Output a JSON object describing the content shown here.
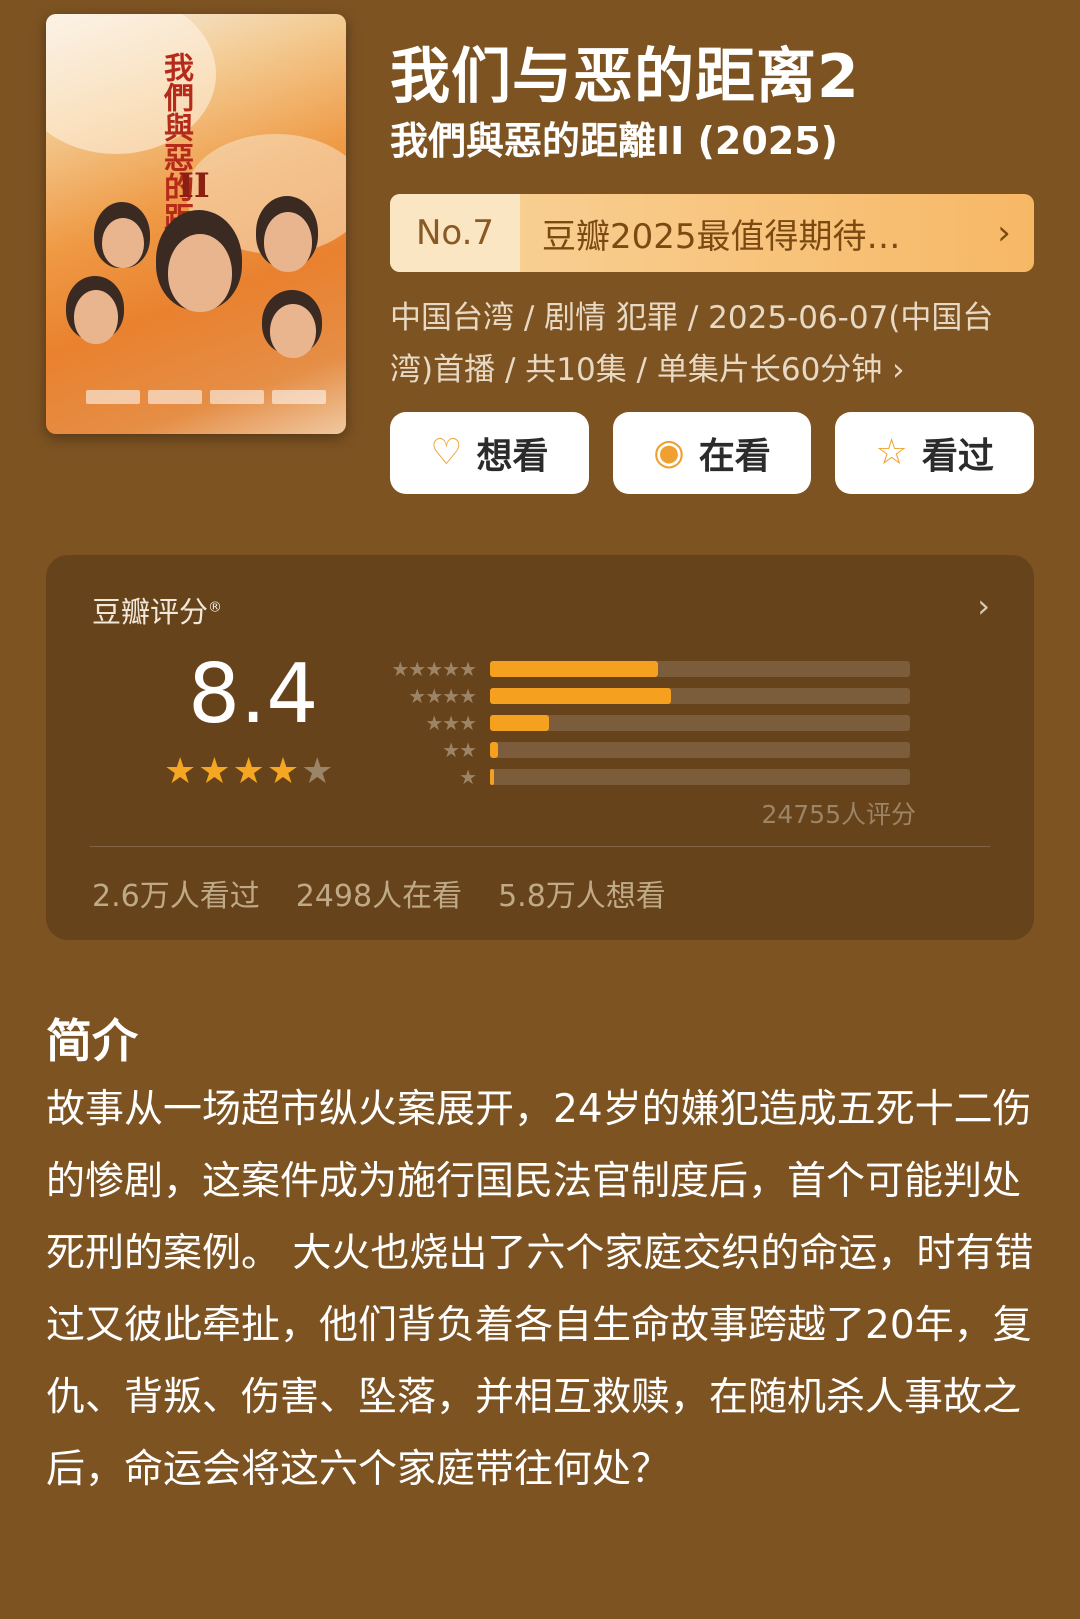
{
  "poster": {
    "title_vertical": "我們與惡的距離",
    "title_roman": "II",
    "alt": "poster"
  },
  "header": {
    "title": "我们与恶的距离2",
    "subtitle": "我們與惡的距離II (2025)"
  },
  "ranking": {
    "number": "No.7",
    "label": "豆瓣2025最值得期待…",
    "chevron": "›"
  },
  "meta": {
    "text": "中国台湾 / 剧情 犯罪 / 2025-06-07(中国台湾)首播 / 共10集 / 单集片长60分钟 ›"
  },
  "actions": {
    "want": {
      "label": "想看",
      "icon": "heart-plus-icon",
      "glyph": "♡"
    },
    "watching": {
      "label": "在看",
      "icon": "target-icon",
      "glyph": "◉"
    },
    "watched": {
      "label": "看过",
      "icon": "star-outline-icon",
      "glyph": "☆"
    }
  },
  "rating": {
    "label": "豆瓣评分",
    "mark": "®",
    "chevron": "›",
    "score": "8.4",
    "stars": 4,
    "star_on": "★★★★",
    "star_off": "★",
    "distribution": [
      {
        "stars": 5,
        "glyph": "★★★★★",
        "pct": 40
      },
      {
        "stars": 4,
        "glyph": "★★★★",
        "pct": 43
      },
      {
        "stars": 3,
        "glyph": "★★★",
        "pct": 14
      },
      {
        "stars": 2,
        "glyph": "★★",
        "pct": 2
      },
      {
        "stars": 1,
        "glyph": "★",
        "pct": 1
      }
    ],
    "count": "24755人评分",
    "watched": "2.6万人看过",
    "watching": "2498人在看",
    "want": "5.8万人想看"
  },
  "intro": {
    "heading": "简介",
    "body": "故事从一场超市纵火案展开，24岁的嫌犯造成五死十二伤的惨剧，这案件成为施行国民法官制度后，首个可能判处死刑的案例。 大火也烧出了六个家庭交织的命运，时有错过又彼此牵扯，他们背负着各自生命故事跨越了20年，复仇、背叛、伤害、坠落，并相互救赎，在随机杀人事故之后，命运会将这六个家庭带往何处？"
  },
  "colors": {
    "background": "#7d5322",
    "accent": "#f5a623",
    "rank_bg": "#f7b866"
  }
}
